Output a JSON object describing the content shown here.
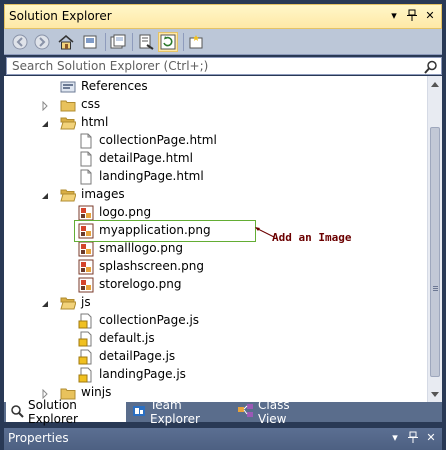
{
  "window": {
    "title": "Solution Explorer",
    "controls": [
      "pin-icon",
      "close-icon",
      "dropdown-icon"
    ]
  },
  "toolbar": {
    "buttons": [
      "back-icon",
      "forward-icon",
      "home-icon",
      "collapse-all-icon",
      "show-all-files-icon",
      "properties-icon",
      "refresh-icon",
      "new-solution-folder-icon"
    ],
    "active_button": "refresh-icon"
  },
  "search": {
    "placeholder": "Search Solution Explorer (Ctrl+;)"
  },
  "tree": {
    "items": [
      {
        "label": "References",
        "icon": "references-icon",
        "level": 0,
        "expander": "none"
      },
      {
        "label": "css",
        "icon": "folder-icon",
        "level": 0,
        "expander": "collapsed"
      },
      {
        "label": "html",
        "icon": "folder-open-icon",
        "level": 0,
        "expander": "expanded"
      },
      {
        "label": "collectionPage.html",
        "icon": "html-file-icon",
        "level": 1,
        "expander": "none"
      },
      {
        "label": "detailPage.html",
        "icon": "html-file-icon",
        "level": 1,
        "expander": "none"
      },
      {
        "label": "landingPage.html",
        "icon": "html-file-icon",
        "level": 1,
        "expander": "none"
      },
      {
        "label": "images",
        "icon": "folder-open-icon",
        "level": 0,
        "expander": "expanded"
      },
      {
        "label": "logo.png",
        "icon": "image-file-icon",
        "level": 1,
        "expander": "none"
      },
      {
        "label": "myapplication.png",
        "icon": "image-file-icon",
        "level": 1,
        "expander": "none"
      },
      {
        "label": "smalllogo.png",
        "icon": "image-file-icon",
        "level": 1,
        "expander": "none"
      },
      {
        "label": "splashscreen.png",
        "icon": "image-file-icon",
        "level": 1,
        "expander": "none"
      },
      {
        "label": "storelogo.png",
        "icon": "image-file-icon",
        "level": 1,
        "expander": "none"
      },
      {
        "label": "js",
        "icon": "folder-open-icon",
        "level": 0,
        "expander": "expanded"
      },
      {
        "label": "collectionPage.js",
        "icon": "js-file-icon",
        "level": 1,
        "expander": "none"
      },
      {
        "label": "default.js",
        "icon": "js-file-icon",
        "level": 1,
        "expander": "none"
      },
      {
        "label": "detailPage.js",
        "icon": "js-file-icon",
        "level": 1,
        "expander": "none"
      },
      {
        "label": "landingPage.js",
        "icon": "js-file-icon",
        "level": 1,
        "expander": "none"
      },
      {
        "label": "winjs",
        "icon": "folder-icon",
        "level": 0,
        "expander": "collapsed"
      }
    ]
  },
  "annotation": {
    "text": "Add an Image",
    "color": "#6b0000",
    "box_color": "#63ad34"
  },
  "tabs": [
    {
      "label": "Solution Explorer",
      "icon": "solution-explorer-icon",
      "active": true
    },
    {
      "label": "Team Explorer",
      "icon": "team-explorer-icon",
      "active": false
    },
    {
      "label": "Class View",
      "icon": "class-view-icon",
      "active": false
    }
  ],
  "properties": {
    "title": "Properties"
  },
  "colors": {
    "background": "#293955",
    "titlebar": "#ffe8a6",
    "toolbar": "#bcc7d8",
    "folder": "#e8c25c",
    "image_icon": "#d4442c"
  }
}
